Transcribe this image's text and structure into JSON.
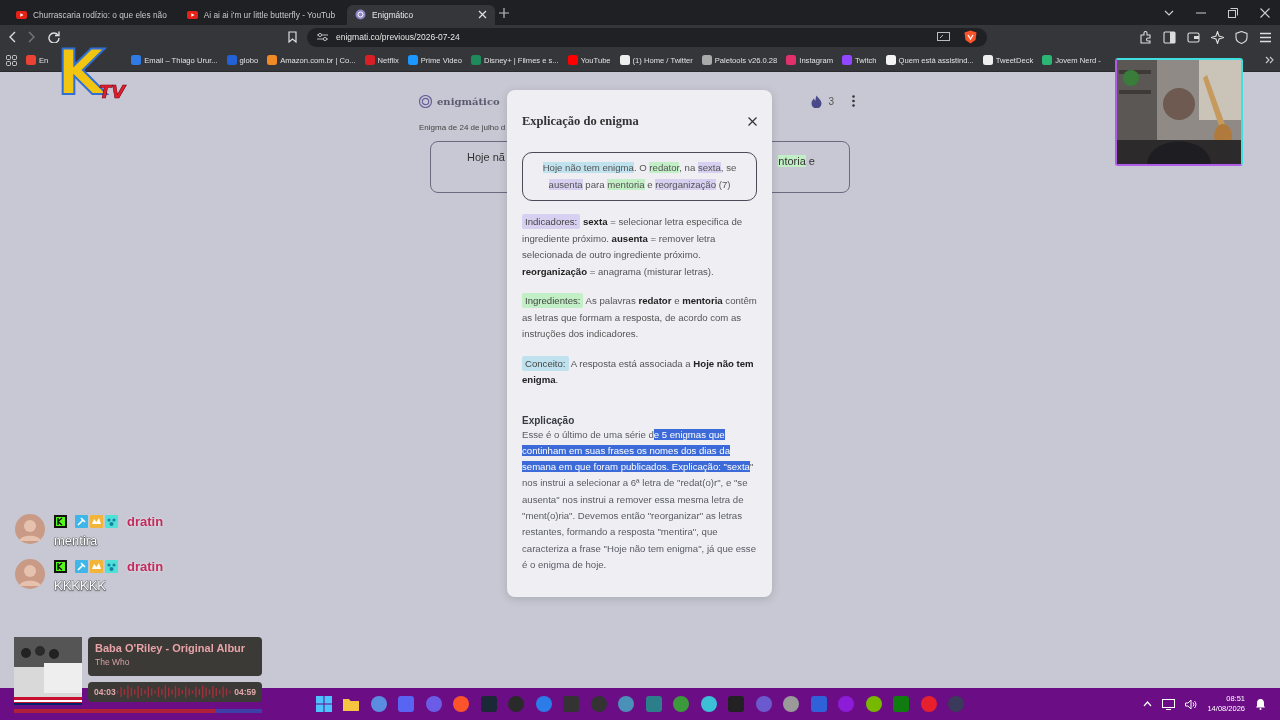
{
  "browser": {
    "tabs": [
      {
        "title": "Churrascaria rodízio: o que eles não",
        "selected": false
      },
      {
        "title": "Ai ai ai i'm ur little butterfly - YouTub",
        "selected": false
      },
      {
        "title": "Enigmático",
        "selected": true
      }
    ],
    "url": "enigmati.co/previous/2026-07-24",
    "bookmarks": [
      "En",
      "Email – Thiago Urur...",
      "globo",
      "Amazon.com.br | Co...",
      "Netflix",
      "Prime Video",
      "Disney+ | Filmes e s...",
      "YouTube",
      "(1) Home / Twitter",
      "Paletools v26.0.28",
      "Instagram",
      "Twitch",
      "Quem está assistind...",
      "TweetDeck",
      "Jovem Nerd -"
    ]
  },
  "overlay_logo": {
    "letter": "K",
    "suffix": "TV"
  },
  "page": {
    "logo": "enigmático",
    "streak": "3",
    "date": "Enigma de 24 de julho d",
    "clue_left": "Hoje nã",
    "clue_right": [
      {
        "text": "ntoria",
        "kind": "ingredient"
      },
      {
        "text": " e",
        "kind": "plain"
      }
    ]
  },
  "modal": {
    "title": "Explicação do enigma",
    "clue": [
      {
        "text": "Hoje não tem enigma",
        "kind": "concept"
      },
      {
        "text": ". O ",
        "kind": "plain"
      },
      {
        "text": "redator",
        "kind": "ingredient"
      },
      {
        "text": ", na ",
        "kind": "plain"
      },
      {
        "text": "sexta",
        "kind": "indicator"
      },
      {
        "text": ", se ",
        "kind": "plain"
      },
      {
        "text": "ausenta",
        "kind": "indicator"
      },
      {
        "text": " para ",
        "kind": "plain"
      },
      {
        "text": "mentoria",
        "kind": "ingredient"
      },
      {
        "text": " e ",
        "kind": "plain"
      },
      {
        "text": "reorganização",
        "kind": "indicator"
      },
      {
        "text": " (7)",
        "kind": "plain"
      }
    ],
    "sections": [
      {
        "kind": "indicator",
        "tag": "Indicadores:",
        "text": "**sexta** = selecionar letra especifica de ingrediente próximo. **ausenta** = remover letra selecionada de outro ingrediente próximo. **reorganização** = anagrama (misturar letras)."
      },
      {
        "kind": "ingredient",
        "tag": "Ingredientes:",
        "text": "As palavras **redator** e **mentoria** contêm as letras que formam a resposta, de acordo com as instruções dos indicadores."
      },
      {
        "kind": "concept",
        "tag": "Conceito:",
        "text": "A resposta está associada a **Hoje não tem enigma**."
      }
    ],
    "explanation_heading": "Explicação",
    "explanation": [
      {
        "text": "Esse é o último de uma série d",
        "selected": false
      },
      {
        "text": "e 5 enigmas que continham em suas frases os nomes dos dias da semana em que foram publicados. Explicação: \"sexta",
        "selected": true
      },
      {
        "text": "\" nos instrui a selecionar a 6ª letra de \"redat(o)r\", e \"se ausenta\" nos instrui a remover essa mesma letra de \"ment(o)ria\". Devemos então \"reorganizar\" as letras restantes, formando a resposta \"mentira\", que caracteriza a frase \"Hoje não tem enigma\", já que esse é o enigma de hoje.",
        "selected": false
      }
    ]
  },
  "chat": [
    {
      "user": "dratin",
      "message": "mentira"
    },
    {
      "user": "dratin",
      "message": "KKKKKK"
    }
  ],
  "music": {
    "title": "Baba O'Riley - Original Albur",
    "artist": "The Who",
    "elapsed": "04:03",
    "duration": "04:59",
    "level": 0.81
  },
  "taskbar": {
    "time": "08:51",
    "date": "14/08/2026"
  }
}
